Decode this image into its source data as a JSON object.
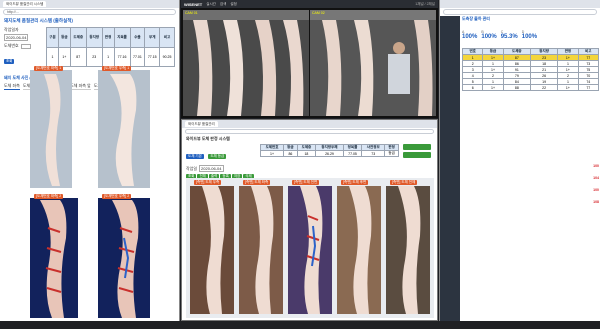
{
  "left_window": {
    "tab_title": "와이드뷰 품질관리 시스템",
    "address": "http://...",
    "page_title": "돼지도체 품질관리 시스템 (출하실적)",
    "filters": {
      "date_label": "작업일자",
      "date_value": "2020-06-04",
      "no_label": "도체번호",
      "search_label": "조회"
    },
    "summary": {
      "headers": [
        "구분",
        "등급",
        "도체중",
        "등지방",
        "판정",
        "지육률",
        "수율",
        "무게",
        "비고"
      ],
      "row": [
        "1",
        "1+",
        "87",
        "23",
        "1",
        "77.16",
        "77.01",
        "77.15",
        "90.25"
      ]
    },
    "section_title": "돼지 도체 사진 (측정 부위)",
    "subtabs": [
      "도체 좌측",
      "도체 우측 앞",
      "도체 우측 뒤",
      "도체 좌측 앞",
      "도체 좌측 뒤"
    ],
    "photo_captions": [
      "[도체번호 좌측] 1",
      "[도체번호 우측] 1",
      "[도체번호 좌측] 2",
      "[도체번호 우측] 2"
    ]
  },
  "cctv_window": {
    "title": "WISENET",
    "menu": [
      "실시간",
      "검색",
      "설정"
    ],
    "status": "1채널 / 2채널",
    "cam_labels": [
      "CAM 01",
      "CAM 02"
    ]
  },
  "mid_window": {
    "tab_title": "와이드뷰 품질관리",
    "page_title": "와이드뷰 도체 판정 시스템",
    "left_label": "도체 기본",
    "right_label": "도체 등급",
    "date_label": "작업일",
    "date_value": "2020-06-04",
    "table_head": [
      "도체번호",
      "등급",
      "도체중",
      "등지방두께",
      "정육률",
      "사전정보",
      "판정"
    ],
    "table_row": [
      "1+",
      "86",
      "18",
      "26.29",
      "77.05",
      "73",
      "등급"
    ],
    "green_buttons": [
      "조회",
      "전체",
      "출력",
      "등록",
      "저장",
      "삭제"
    ],
    "section_title": "도체 측정 사진",
    "photo_captions": [
      "[측면] 도체 우측",
      "[측면] 도체 좌측",
      "[측면] 도체 전면",
      "[측면] 도체 후면",
      "[측면] 도체 전체"
    ]
  },
  "right_window": {
    "title": "도축장 출하 관리",
    "kpis": [
      "100%",
      "100%",
      "95.3%",
      "100%"
    ],
    "kpi_labels": [
      "A",
      "B",
      "C",
      "D"
    ],
    "grade_head": [
      "번호",
      "등급",
      "도체중",
      "등지방",
      "판정",
      "비고"
    ],
    "rows": [
      [
        "1",
        "1+",
        "87",
        "23",
        "1+",
        "77"
      ],
      [
        "2",
        "1",
        "86",
        "18",
        "1",
        "73"
      ],
      [
        "3",
        "1+",
        "91",
        "21",
        "1+",
        "75"
      ],
      [
        "4",
        "2",
        "79",
        "26",
        "2",
        "70"
      ],
      [
        "5",
        "1",
        "84",
        "19",
        "1",
        "74"
      ],
      [
        "6",
        "1+",
        "88",
        "22",
        "1+",
        "77"
      ]
    ],
    "side_values": [
      "100",
      "104",
      "100",
      "108"
    ]
  },
  "colors": {
    "accent_blue": "#1f5fbf",
    "orange": "#e05a2a",
    "green": "#3a9a3a",
    "yellow": "#f3d53b",
    "red": "#d6262b"
  }
}
